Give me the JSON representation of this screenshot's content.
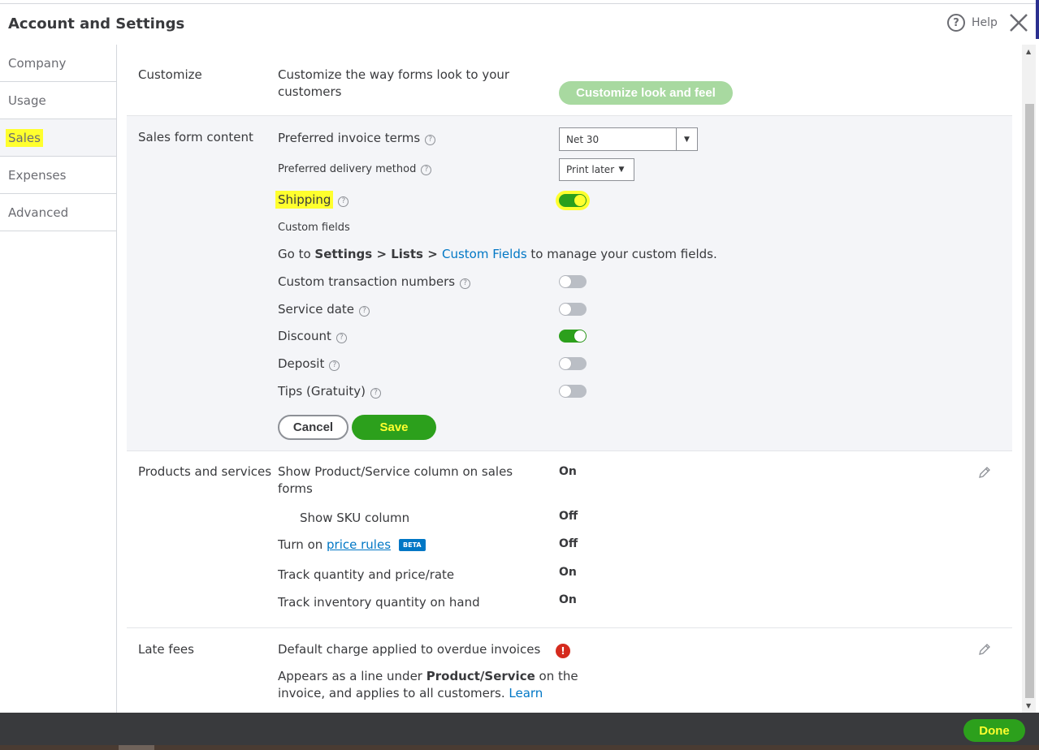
{
  "header": {
    "title": "Account and Settings",
    "help_label": "Help",
    "help_glyph": "?"
  },
  "sidebar": {
    "items": [
      {
        "label": "Company"
      },
      {
        "label": "Usage"
      },
      {
        "label": "Sales"
      },
      {
        "label": "Expenses"
      },
      {
        "label": "Advanced"
      }
    ],
    "active": "Sales"
  },
  "customize": {
    "title": "Customize",
    "desc_line1": "Customize the way forms look to your",
    "desc_line2": "customers",
    "button_label": "Customize look and feel"
  },
  "sales_form": {
    "title": "Sales form content",
    "invoice_terms_label": "Preferred invoice terms",
    "invoice_terms_value": "Net 30",
    "delivery_label": "Preferred delivery method",
    "delivery_value": "Print later",
    "shipping_label": "Shipping",
    "shipping_on": true,
    "custom_fields_label": "Custom fields",
    "custom_fields_note": {
      "pre": "Go to ",
      "bold1": "Settings",
      "sep1": " > ",
      "bold2": "Lists",
      "sep2": " > ",
      "link": "Custom Fields",
      "post": " to manage your custom fields."
    },
    "toggles": [
      {
        "label": "Custom transaction numbers",
        "on": false
      },
      {
        "label": "Service date",
        "on": false
      },
      {
        "label": "Discount",
        "on": true
      },
      {
        "label": "Deposit",
        "on": false
      },
      {
        "label": "Tips (Gratuity)",
        "on": false
      }
    ],
    "cancel_label": "Cancel",
    "save_label": "Save",
    "help_glyph": "?"
  },
  "products": {
    "title": "Products and services",
    "rows": [
      {
        "label_line1": "Show Product/Service column on sales",
        "label_line2": "forms",
        "value": "On"
      },
      {
        "label": "Show SKU column",
        "value": "Off"
      },
      {
        "label_pre": "Turn on ",
        "label_link": "price rules",
        "badge": "BETA",
        "value": "Off"
      },
      {
        "label": "Track quantity and price/rate",
        "value": "On"
      },
      {
        "label": "Track inventory quantity on hand",
        "value": "On"
      }
    ]
  },
  "late_fees": {
    "title": "Late fees",
    "row_label": "Default charge applied to overdue invoices",
    "error_glyph": "!",
    "desc_pre": "Appears as a line under ",
    "desc_bold": "Product/Service",
    "desc_post": " on the",
    "desc_line2": "invoice, and applies to all customers. ",
    "desc_link": "Learn"
  },
  "footer": {
    "done_label": "Done"
  },
  "colors": {
    "accent_green": "#2ca01c",
    "link_blue": "#0077c5",
    "highlight_yellow": "#ffff2e",
    "footer_dark": "#393a3d"
  }
}
